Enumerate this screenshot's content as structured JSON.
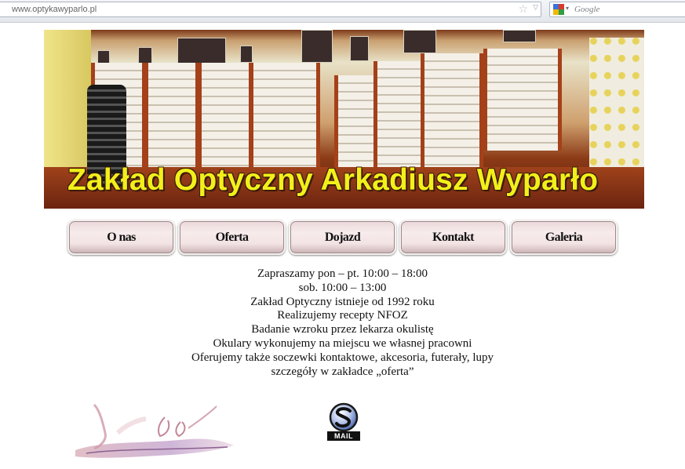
{
  "browser": {
    "url_host": "www.optykawyparlo.pl",
    "search_placeholder": "Google",
    "icons": {
      "bookmark": "star-icon",
      "dropdown": "chevron-down-icon",
      "search_engine": "google-icon"
    }
  },
  "banner": {
    "title": "Zakład Optyczny Arkadiusz Wyparło",
    "title_color": "#f2ef1a"
  },
  "nav": {
    "items": [
      {
        "label": "O nas"
      },
      {
        "label": "Oferta"
      },
      {
        "label": "Dojazd"
      },
      {
        "label": "Kontakt"
      },
      {
        "label": "Galeria"
      }
    ]
  },
  "content": {
    "lines": [
      "Zapraszamy pon – pt. 10:00 – 18:00",
      "sob. 10:00 – 13:00",
      "Zakład Optyczny istnieje od 1992 roku",
      "Realizujemy recepty NFOZ",
      "Badanie wzroku przez lekarza okulistę",
      "Okulary wykonujemy na miejscu we własnej pracowni",
      "Oferujemy także soczewki kontaktowe, akcesoria, futerały, lupy",
      "szczegóły w zakładce „oferta”"
    ]
  },
  "footer": {
    "mail_label": "MAIL",
    "icons": {
      "decoration": "eyeglasses-icon",
      "mail": "mail-icon"
    }
  }
}
